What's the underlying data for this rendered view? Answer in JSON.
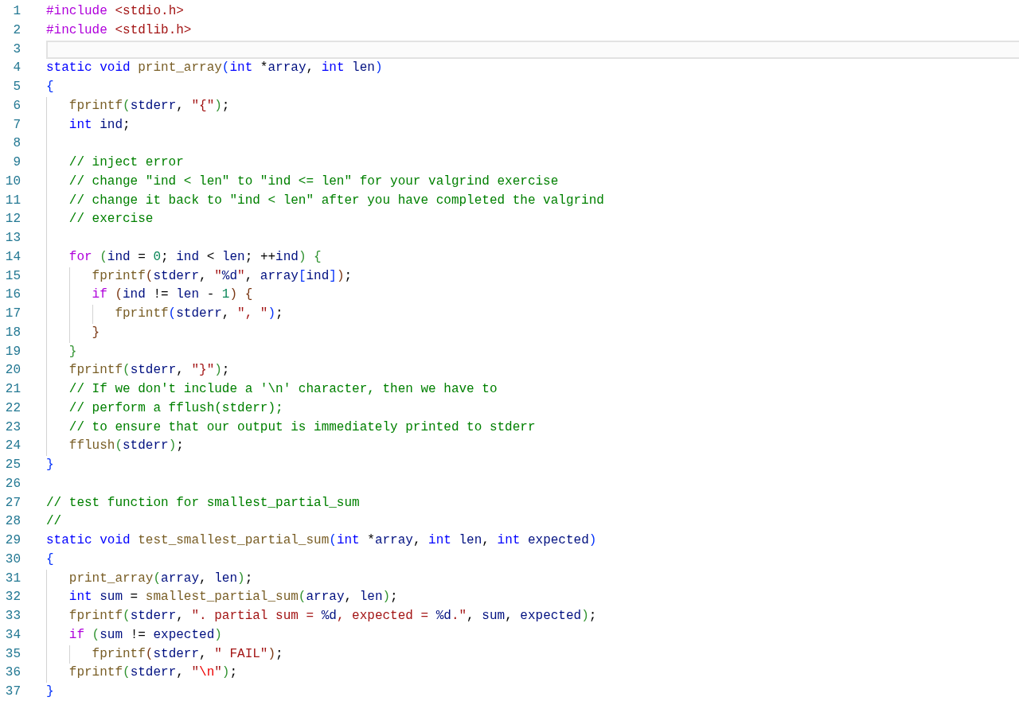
{
  "editor": {
    "lines": [
      {
        "number": "1",
        "current": false,
        "tokens": [
          {
            "text": "#include ",
            "kind": "kw"
          },
          {
            "text": "<stdio.h>",
            "kind": "str"
          }
        ]
      },
      {
        "number": "2",
        "current": false,
        "tokens": [
          {
            "text": "#include ",
            "kind": "kw"
          },
          {
            "text": "<stdlib.h>",
            "kind": "str"
          }
        ]
      },
      {
        "number": "3",
        "current": true
      },
      {
        "number": "4",
        "current": false,
        "tokens": [
          {
            "text": "static void ",
            "kind": "type"
          },
          {
            "text": "print_array",
            "kind": "fn"
          },
          {
            "text": "(",
            "kind": "b1"
          },
          {
            "text": "int ",
            "kind": "type"
          },
          {
            "text": "*",
            "kind": "plain"
          },
          {
            "text": "array",
            "kind": "var"
          },
          {
            "text": ", ",
            "kind": "plain"
          },
          {
            "text": "int ",
            "kind": "type"
          },
          {
            "text": "len",
            "kind": "var"
          },
          {
            "text": ")",
            "kind": "b1"
          }
        ]
      },
      {
        "number": "5",
        "current": false,
        "tokens": [
          {
            "text": "{",
            "kind": "b1"
          }
        ],
        "children": [
          {
            "number": "6",
            "current": false,
            "tokens": [
              {
                "text": "fprintf",
                "kind": "fn"
              },
              {
                "text": "(",
                "kind": "b2"
              },
              {
                "text": "stderr",
                "kind": "var"
              },
              {
                "text": ", ",
                "kind": "plain"
              },
              {
                "text": "\"{\"",
                "kind": "str"
              },
              {
                "text": ")",
                "kind": "b2"
              },
              {
                "text": ";",
                "kind": "plain"
              }
            ]
          },
          {
            "number": "7",
            "current": false,
            "tokens": [
              {
                "text": "int ",
                "kind": "type"
              },
              {
                "text": "ind",
                "kind": "var"
              },
              {
                "text": ";",
                "kind": "plain"
              }
            ]
          },
          {
            "number": "8",
            "current": false
          },
          {
            "number": "9",
            "current": false,
            "tokens": [
              {
                "text": "// inject error",
                "kind": "cmt"
              }
            ]
          },
          {
            "number": "10",
            "current": false,
            "tokens": [
              {
                "text": "// change \"ind < len\" to \"ind <= len\" for your valgrind exercise",
                "kind": "cmt"
              }
            ]
          },
          {
            "number": "11",
            "current": false,
            "tokens": [
              {
                "text": "// change it back to \"ind < len\" after you have completed the valgrind",
                "kind": "cmt"
              }
            ]
          },
          {
            "number": "12",
            "current": false,
            "tokens": [
              {
                "text": "// exercise",
                "kind": "cmt"
              }
            ]
          },
          {
            "number": "13",
            "current": false
          },
          {
            "number": "14",
            "current": false,
            "tokens": [
              {
                "text": "for ",
                "kind": "kw"
              },
              {
                "text": "(",
                "kind": "b2"
              },
              {
                "text": "ind",
                "kind": "var"
              },
              {
                "text": " = ",
                "kind": "plain"
              },
              {
                "text": "0",
                "kind": "num"
              },
              {
                "text": "; ",
                "kind": "plain"
              },
              {
                "text": "ind",
                "kind": "var"
              },
              {
                "text": " < ",
                "kind": "plain"
              },
              {
                "text": "len",
                "kind": "var"
              },
              {
                "text": "; ++",
                "kind": "plain"
              },
              {
                "text": "ind",
                "kind": "var"
              },
              {
                "text": ")",
                "kind": "b2"
              },
              {
                "text": " {",
                "kind": "b2"
              }
            ],
            "children": [
              {
                "number": "15",
                "current": false,
                "tokens": [
                  {
                    "text": "fprintf",
                    "kind": "fn"
                  },
                  {
                    "text": "(",
                    "kind": "b3"
                  },
                  {
                    "text": "stderr",
                    "kind": "var"
                  },
                  {
                    "text": ", ",
                    "kind": "plain"
                  },
                  {
                    "text": "\"",
                    "kind": "str"
                  },
                  {
                    "text": "%d",
                    "kind": "fmt"
                  },
                  {
                    "text": "\"",
                    "kind": "str"
                  },
                  {
                    "text": ", ",
                    "kind": "plain"
                  },
                  {
                    "text": "array",
                    "kind": "var"
                  },
                  {
                    "text": "[",
                    "kind": "b1"
                  },
                  {
                    "text": "ind",
                    "kind": "var"
                  },
                  {
                    "text": "]",
                    "kind": "b1"
                  },
                  {
                    "text": ")",
                    "kind": "b3"
                  },
                  {
                    "text": ";",
                    "kind": "plain"
                  }
                ]
              },
              {
                "number": "16",
                "current": false,
                "tokens": [
                  {
                    "text": "if ",
                    "kind": "kw"
                  },
                  {
                    "text": "(",
                    "kind": "b3"
                  },
                  {
                    "text": "ind",
                    "kind": "var"
                  },
                  {
                    "text": " != ",
                    "kind": "plain"
                  },
                  {
                    "text": "len",
                    "kind": "var"
                  },
                  {
                    "text": " - ",
                    "kind": "plain"
                  },
                  {
                    "text": "1",
                    "kind": "num"
                  },
                  {
                    "text": ")",
                    "kind": "b3"
                  },
                  {
                    "text": " {",
                    "kind": "b3"
                  }
                ],
                "children": [
                  {
                    "number": "17",
                    "current": false,
                    "tokens": [
                      {
                        "text": "fprintf",
                        "kind": "fn"
                      },
                      {
                        "text": "(",
                        "kind": "b1"
                      },
                      {
                        "text": "stderr",
                        "kind": "var"
                      },
                      {
                        "text": ", ",
                        "kind": "plain"
                      },
                      {
                        "text": "\", \"",
                        "kind": "str"
                      },
                      {
                        "text": ")",
                        "kind": "b1"
                      },
                      {
                        "text": ";",
                        "kind": "plain"
                      }
                    ]
                  }
                ]
              },
              {
                "number": "18",
                "current": false,
                "tokens": [
                  {
                    "text": "}",
                    "kind": "b3"
                  }
                ]
              }
            ]
          },
          {
            "number": "19",
            "current": false,
            "tokens": [
              {
                "text": "}",
                "kind": "b2"
              }
            ]
          },
          {
            "number": "20",
            "current": false,
            "tokens": [
              {
                "text": "fprintf",
                "kind": "fn"
              },
              {
                "text": "(",
                "kind": "b2"
              },
              {
                "text": "stderr",
                "kind": "var"
              },
              {
                "text": ", ",
                "kind": "plain"
              },
              {
                "text": "\"}\"",
                "kind": "str"
              },
              {
                "text": ")",
                "kind": "b2"
              },
              {
                "text": ";",
                "kind": "plain"
              }
            ]
          },
          {
            "number": "21",
            "current": false,
            "tokens": [
              {
                "text": "// If we don't include a '\\n' character, then we have to",
                "kind": "cmt"
              }
            ]
          },
          {
            "number": "22",
            "current": false,
            "tokens": [
              {
                "text": "// perform a fflush(stderr);",
                "kind": "cmt"
              }
            ]
          },
          {
            "number": "23",
            "current": false,
            "tokens": [
              {
                "text": "// to ensure that our output is immediately printed to stderr",
                "kind": "cmt"
              }
            ]
          },
          {
            "number": "24",
            "current": false,
            "tokens": [
              {
                "text": "fflush",
                "kind": "fn"
              },
              {
                "text": "(",
                "kind": "b2"
              },
              {
                "text": "stderr",
                "kind": "var"
              },
              {
                "text": ")",
                "kind": "b2"
              },
              {
                "text": ";",
                "kind": "plain"
              }
            ]
          }
        ]
      },
      {
        "number": "25",
        "current": false,
        "tokens": [
          {
            "text": "}",
            "kind": "b1"
          }
        ]
      },
      {
        "number": "26",
        "current": false
      },
      {
        "number": "27",
        "current": false,
        "tokens": [
          {
            "text": "// test function for smallest_partial_sum",
            "kind": "cmt"
          }
        ]
      },
      {
        "number": "28",
        "current": false,
        "tokens": [
          {
            "text": "//",
            "kind": "cmt"
          }
        ]
      },
      {
        "number": "29",
        "current": false,
        "tokens": [
          {
            "text": "static void ",
            "kind": "type"
          },
          {
            "text": "test_smallest_partial_sum",
            "kind": "fn"
          },
          {
            "text": "(",
            "kind": "b1"
          },
          {
            "text": "int ",
            "kind": "type"
          },
          {
            "text": "*",
            "kind": "plain"
          },
          {
            "text": "array",
            "kind": "var"
          },
          {
            "text": ", ",
            "kind": "plain"
          },
          {
            "text": "int ",
            "kind": "type"
          },
          {
            "text": "len",
            "kind": "var"
          },
          {
            "text": ", ",
            "kind": "plain"
          },
          {
            "text": "int ",
            "kind": "type"
          },
          {
            "text": "expected",
            "kind": "var"
          },
          {
            "text": ")",
            "kind": "b1"
          }
        ]
      },
      {
        "number": "30",
        "current": false,
        "tokens": [
          {
            "text": "{",
            "kind": "b1"
          }
        ],
        "children": [
          {
            "number": "31",
            "current": false,
            "tokens": [
              {
                "text": "print_array",
                "kind": "fn"
              },
              {
                "text": "(",
                "kind": "b2"
              },
              {
                "text": "array",
                "kind": "var"
              },
              {
                "text": ", ",
                "kind": "plain"
              },
              {
                "text": "len",
                "kind": "var"
              },
              {
                "text": ")",
                "kind": "b2"
              },
              {
                "text": ";",
                "kind": "plain"
              }
            ]
          },
          {
            "number": "32",
            "current": false,
            "tokens": [
              {
                "text": "int ",
                "kind": "type"
              },
              {
                "text": "sum",
                "kind": "var"
              },
              {
                "text": " = ",
                "kind": "plain"
              },
              {
                "text": "smallest_partial_sum",
                "kind": "fn"
              },
              {
                "text": "(",
                "kind": "b2"
              },
              {
                "text": "array",
                "kind": "var"
              },
              {
                "text": ", ",
                "kind": "plain"
              },
              {
                "text": "len",
                "kind": "var"
              },
              {
                "text": ")",
                "kind": "b2"
              },
              {
                "text": ";",
                "kind": "plain"
              }
            ]
          },
          {
            "number": "33",
            "current": false,
            "tokens": [
              {
                "text": "fprintf",
                "kind": "fn"
              },
              {
                "text": "(",
                "kind": "b2"
              },
              {
                "text": "stderr",
                "kind": "var"
              },
              {
                "text": ", ",
                "kind": "plain"
              },
              {
                "text": "\". partial sum = ",
                "kind": "str"
              },
              {
                "text": "%d",
                "kind": "fmt"
              },
              {
                "text": ", expected = ",
                "kind": "str"
              },
              {
                "text": "%d",
                "kind": "fmt"
              },
              {
                "text": ".\"",
                "kind": "str"
              },
              {
                "text": ", ",
                "kind": "plain"
              },
              {
                "text": "sum",
                "kind": "var"
              },
              {
                "text": ", ",
                "kind": "plain"
              },
              {
                "text": "expected",
                "kind": "var"
              },
              {
                "text": ")",
                "kind": "b2"
              },
              {
                "text": ";",
                "kind": "plain"
              }
            ]
          },
          {
            "number": "34",
            "current": false,
            "tokens": [
              {
                "text": "if ",
                "kind": "kw"
              },
              {
                "text": "(",
                "kind": "b2"
              },
              {
                "text": "sum",
                "kind": "var"
              },
              {
                "text": " != ",
                "kind": "plain"
              },
              {
                "text": "expected",
                "kind": "var"
              },
              {
                "text": ")",
                "kind": "b2"
              }
            ],
            "children": [
              {
                "number": "35",
                "current": false,
                "tokens": [
                  {
                    "text": "fprintf",
                    "kind": "fn"
                  },
                  {
                    "text": "(",
                    "kind": "b3"
                  },
                  {
                    "text": "stderr",
                    "kind": "var"
                  },
                  {
                    "text": ", ",
                    "kind": "plain"
                  },
                  {
                    "text": "\" FAIL\"",
                    "kind": "str"
                  },
                  {
                    "text": ")",
                    "kind": "b3"
                  },
                  {
                    "text": ";",
                    "kind": "plain"
                  }
                ]
              }
            ]
          },
          {
            "number": "36",
            "current": false,
            "tokens": [
              {
                "text": "fprintf",
                "kind": "fn"
              },
              {
                "text": "(",
                "kind": "b2"
              },
              {
                "text": "stderr",
                "kind": "var"
              },
              {
                "text": ", ",
                "kind": "plain"
              },
              {
                "text": "\"",
                "kind": "str"
              },
              {
                "text": "\\n",
                "kind": "esc"
              },
              {
                "text": "\"",
                "kind": "str"
              },
              {
                "text": ")",
                "kind": "b2"
              },
              {
                "text": ";",
                "kind": "plain"
              }
            ]
          }
        ]
      },
      {
        "number": "37",
        "current": false,
        "tokens": [
          {
            "text": "}",
            "kind": "b1"
          }
        ]
      }
    ]
  }
}
